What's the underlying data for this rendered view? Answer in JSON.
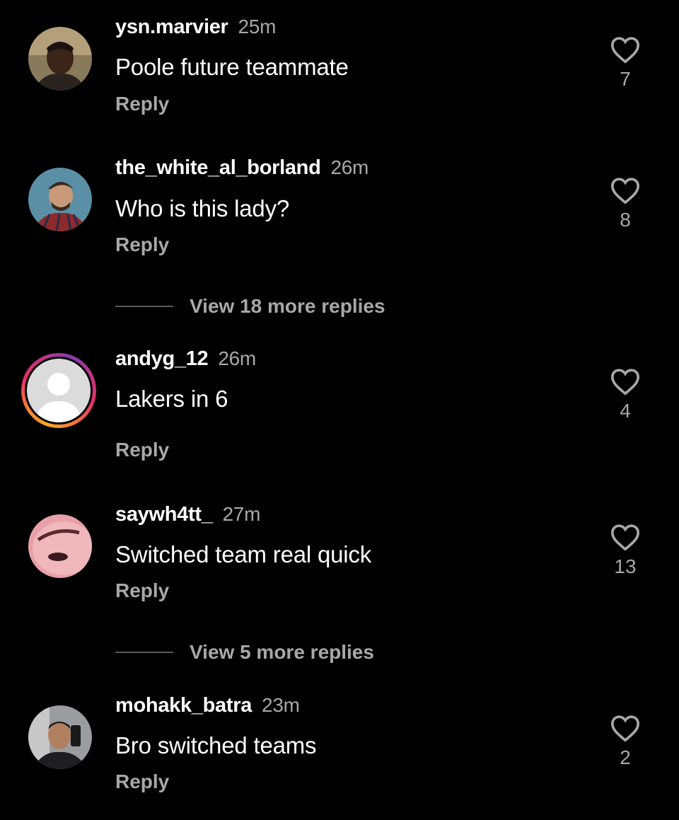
{
  "comments": [
    {
      "username": "ysn.marvier",
      "time": "25m",
      "text": "Poole future teammate",
      "reply_label": "Reply",
      "likes": "7",
      "avatar_icon": "profile-photo"
    },
    {
      "username": "the_white_al_borland",
      "time": "26m",
      "text": "Who is this lady?",
      "reply_label": "Reply",
      "likes": "8",
      "avatar_icon": "profile-photo"
    },
    {
      "username": "andyg_12",
      "time": "26m",
      "text": "Lakers in 6",
      "reply_label": "Reply",
      "likes": "4",
      "avatar_icon": "default-avatar-with-story-ring"
    },
    {
      "username": "saywh4tt_",
      "time": "27m",
      "text": "Switched team real quick",
      "reply_label": "Reply",
      "likes": "13",
      "avatar_icon": "profile-photo"
    },
    {
      "username": "mohakk_batra",
      "time": "23m",
      "text": "Bro switched teams",
      "reply_label": "Reply",
      "likes": "2",
      "avatar_icon": "profile-photo"
    }
  ],
  "view_more": [
    {
      "label": "View 18 more replies"
    },
    {
      "label": "View 5 more replies"
    }
  ],
  "colors": {
    "background": "#000000",
    "primary_text": "#ffffff",
    "secondary_text": "#a8a8a8",
    "divider": "#5a5a5a"
  },
  "icons": {
    "like": "heart-outline-icon"
  }
}
